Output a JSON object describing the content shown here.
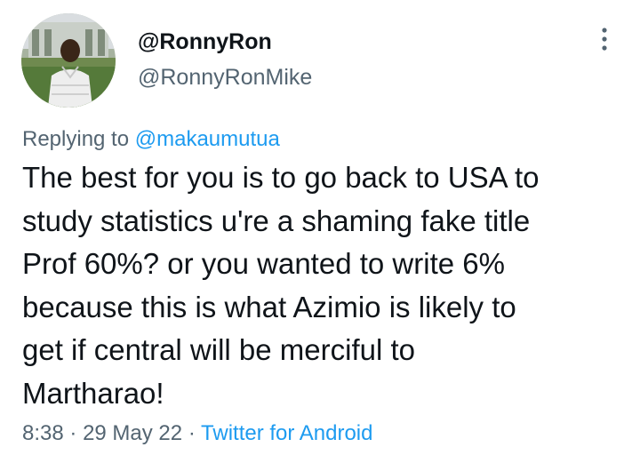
{
  "author": {
    "display_name": "@RonnyRon",
    "handle": "@RonnyRonMike"
  },
  "reply": {
    "prefix": "Replying to",
    "mention": "@makaumutua"
  },
  "tweet": {
    "text_lines": [
      "The best for you is to go back to USA to",
      "study statistics u're a shaming fake title",
      "Prof 60%? or you wanted to write 6%",
      "because this is what Azimio is likely to",
      "get if central will be merciful to",
      "Martharao!"
    ]
  },
  "meta": {
    "time": "8:38",
    "separator": "·",
    "date": "29 May 22",
    "source": "Twitter for Android"
  },
  "icons": {
    "more": "more-vertical-icon",
    "avatar": "profile-photo"
  },
  "colors": {
    "text": "#0f1419",
    "secondary": "#536471",
    "link": "#1d9bf0",
    "background": "#ffffff"
  }
}
